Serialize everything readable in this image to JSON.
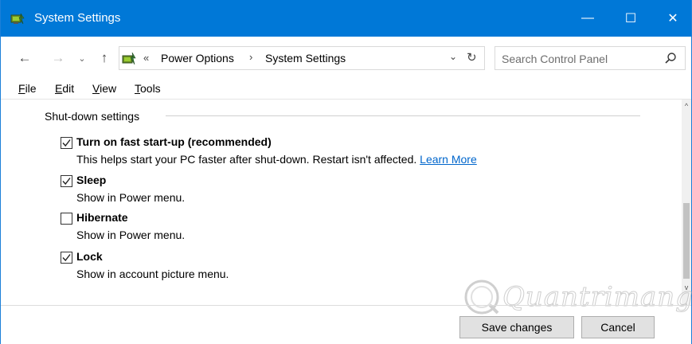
{
  "window": {
    "title": "System Settings",
    "controls": {
      "minimize": "—",
      "maximize": "☐",
      "close": "✕"
    }
  },
  "nav": {
    "back": "←",
    "forward": "→",
    "recent": "⌄",
    "up": "↑",
    "address": {
      "separator": "«",
      "crumbs": [
        "Power Options",
        "System Settings"
      ],
      "chevron": "›",
      "dropdown": "⌄",
      "refresh": "↻"
    },
    "search": {
      "placeholder": "Search Control Panel"
    }
  },
  "menu": {
    "file": {
      "key": "F",
      "rest": "ile"
    },
    "edit": {
      "key": "E",
      "rest": "dit"
    },
    "view": {
      "key": "V",
      "rest": "iew"
    },
    "tools": {
      "key": "T",
      "rest": "ools"
    }
  },
  "content": {
    "section_title": "Shut-down settings",
    "options": [
      {
        "label": "Turn on fast start-up (recommended)",
        "checked": true,
        "description": "This helps start your PC faster after shut-down. Restart isn't affected. ",
        "link": "Learn More"
      },
      {
        "label": "Sleep",
        "checked": true,
        "description": "Show in Power menu."
      },
      {
        "label": "Hibernate",
        "checked": false,
        "description": "Show in Power menu."
      },
      {
        "label": "Lock",
        "checked": true,
        "description": "Show in account picture menu."
      }
    ]
  },
  "scrollbar": {
    "up": "^",
    "down": "v"
  },
  "footer": {
    "save_label": "Save changes",
    "cancel_label": "Cancel"
  },
  "watermark": {
    "text": "Quantrimang"
  },
  "colors": {
    "titlebar": "#0078d7",
    "link": "#0066cc",
    "button_bg": "#e1e1e1"
  }
}
